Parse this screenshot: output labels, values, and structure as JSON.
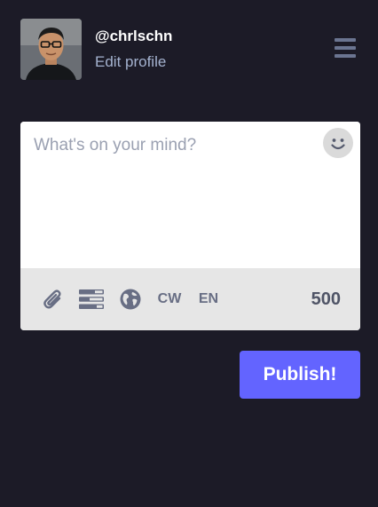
{
  "account": {
    "username": "@chrlschn",
    "edit_profile_label": "Edit profile",
    "avatar_icon": "avatar-photo"
  },
  "header": {
    "menu_icon": "hamburger-menu-icon"
  },
  "compose": {
    "placeholder": "What's on your mind?",
    "value": "",
    "emoji_icon": "smiley-face-icon",
    "toolbar": {
      "attach_icon": "paperclip-icon",
      "poll_icon": "poll-icon",
      "visibility_icon": "globe-icon",
      "cw_label": "CW",
      "language_label": "EN",
      "char_count": "500"
    }
  },
  "publish": {
    "label": "Publish!"
  },
  "colors": {
    "background": "#1c1b27",
    "accent": "#6364ff",
    "secondary_text": "#a4b2cf",
    "toolbar_bg": "#e6e6e6"
  }
}
